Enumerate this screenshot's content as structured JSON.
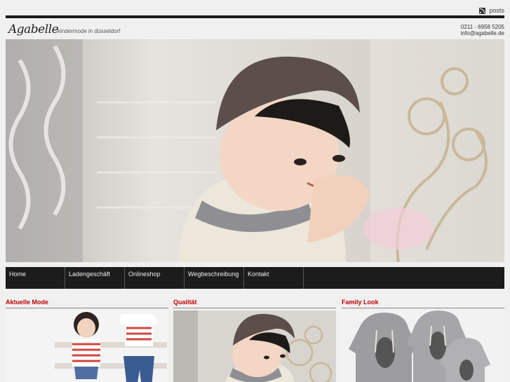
{
  "topbar": {
    "feed_label": "posts"
  },
  "header": {
    "logo": "Agabelle",
    "tagline": "kindermode in düsseldorf",
    "phone": "0211 - 6958 5205",
    "email": "info@agabelle.de"
  },
  "nav": {
    "items": [
      {
        "label": "Home"
      },
      {
        "label": "Ladengeschäft"
      },
      {
        "label": "Onlineshop"
      },
      {
        "label": "Wegbeschreibung"
      },
      {
        "label": "Kontakt"
      }
    ]
  },
  "sections": [
    {
      "title": "Aktuelle Mode"
    },
    {
      "title": "Qualität"
    },
    {
      "title": "Family Look"
    }
  ],
  "colors": {
    "accent": "#c00000",
    "nav_bg": "#1c1c1c"
  }
}
